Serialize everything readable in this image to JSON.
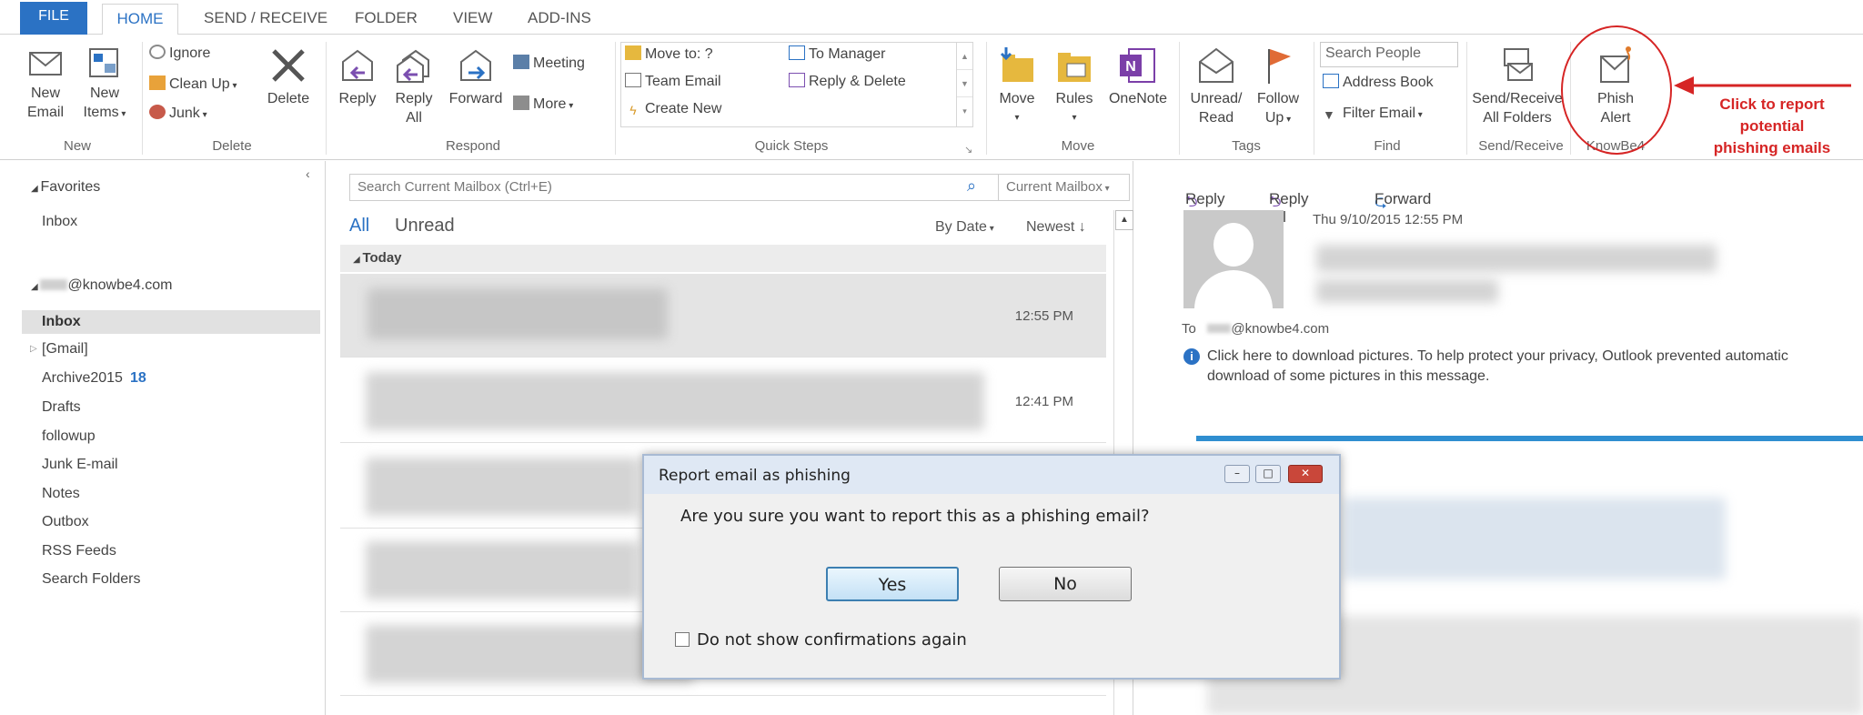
{
  "tabs": [
    "FILE",
    "HOME",
    "SEND / RECEIVE",
    "FOLDER",
    "VIEW",
    "ADD-INS"
  ],
  "ribbon": {
    "new": {
      "new_email": [
        "New",
        "Email"
      ],
      "new_items": [
        "New",
        "Items"
      ],
      "group": "New"
    },
    "delete": {
      "ignore": "Ignore",
      "clean_up": "Clean Up",
      "junk": "Junk",
      "delete": "Delete",
      "group": "Delete"
    },
    "respond": {
      "reply": "Reply",
      "reply_all": [
        "Reply",
        "All"
      ],
      "forward": "Forward",
      "meeting": "Meeting",
      "more": "More",
      "group": "Respond"
    },
    "quick_steps": {
      "items": [
        "Move to: ?",
        "Team Email",
        "Create New",
        "To Manager",
        "Reply & Delete"
      ],
      "group": "Quick Steps"
    },
    "move": {
      "move": "Move",
      "rules": "Rules",
      "onenote": "OneNote",
      "group": "Move"
    },
    "tags": {
      "unread_read": [
        "Unread/",
        "Read"
      ],
      "follow_up": [
        "Follow",
        "Up"
      ],
      "group": "Tags"
    },
    "find": {
      "search_people_placeholder": "Search People",
      "address_book": "Address Book",
      "filter_email": "Filter Email",
      "group": "Find"
    },
    "send_receive": {
      "label": [
        "Send/Receive",
        "All Folders"
      ],
      "group": "Send/Receive"
    },
    "knowbe4": {
      "phish_alert": [
        "Phish",
        "Alert"
      ],
      "group": "KnowBe4"
    }
  },
  "annotation": [
    "Click to report",
    "potential",
    "phishing emails"
  ],
  "folders": {
    "favorites_label": "Favorites",
    "favorites": [
      "Inbox"
    ],
    "account": "@knowbe4.com",
    "items": [
      {
        "label": "Inbox",
        "selected": true
      },
      {
        "label": "[Gmail]"
      },
      {
        "label": "Archive2015",
        "count": "18"
      },
      {
        "label": "Drafts"
      },
      {
        "label": "followup"
      },
      {
        "label": "Junk E-mail"
      },
      {
        "label": "Notes"
      },
      {
        "label": "Outbox"
      },
      {
        "label": "RSS Feeds"
      },
      {
        "label": "Search Folders"
      }
    ]
  },
  "mail_list": {
    "search_placeholder": "Search Current Mailbox (Ctrl+E)",
    "scope": "Current Mailbox",
    "filter_all": "All",
    "filter_unread": "Unread",
    "sort_by": "By Date",
    "sort_order": "Newest",
    "group_today": "Today",
    "times": [
      "12:55 PM",
      "12:41 PM"
    ]
  },
  "reading_pane": {
    "actions": [
      "Reply",
      "Reply All",
      "Forward"
    ],
    "date": "Thu 9/10/2015 12:55 PM",
    "to_label": "To",
    "to_value": "@knowbe4.com",
    "info": [
      "Click here to download pictures. To help protect your privacy, Outlook prevented automatic",
      "download of some pictures in this message."
    ]
  },
  "dialog": {
    "title": "Report email as phishing",
    "message": "Are you sure you want to report this as a phishing email?",
    "yes": "Yes",
    "no": "No",
    "checkbox_label": "Do not show confirmations again"
  },
  "colors": {
    "accent": "#2b72c4",
    "annotation": "#d62525",
    "reading_divider": "#2f8ed0"
  }
}
